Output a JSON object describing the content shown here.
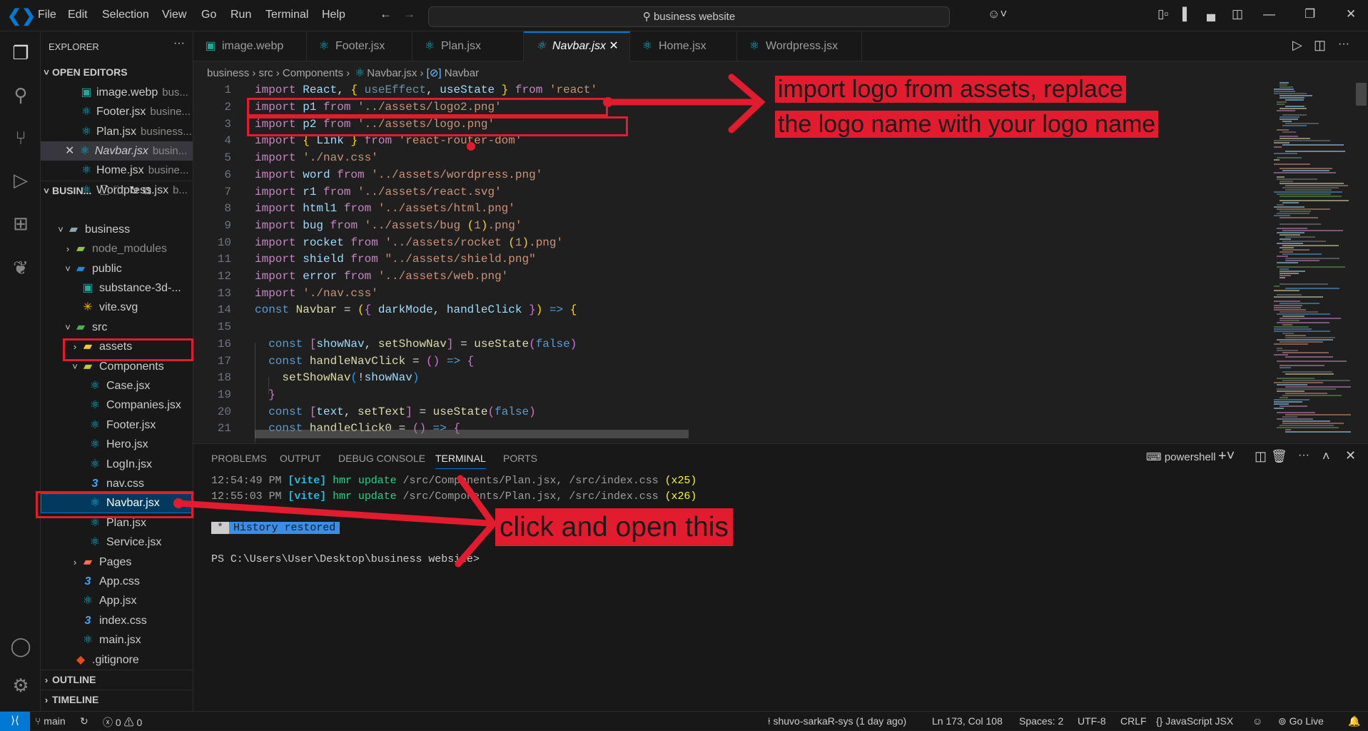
{
  "titlebar": {
    "menu": [
      "File",
      "Edit",
      "Selection",
      "View",
      "Go",
      "Run",
      "Terminal",
      "Help"
    ],
    "search": "business website"
  },
  "explorer": {
    "title": "EXPLORER",
    "open_editors_header": "OPEN EDITORS",
    "open_editors": [
      {
        "name": "image.webp",
        "desc": "bus...",
        "icon": "image"
      },
      {
        "name": "Footer.jsx",
        "desc": "busine...",
        "icon": "react"
      },
      {
        "name": "Plan.jsx",
        "desc": "business...",
        "icon": "react"
      },
      {
        "name": "Navbar.jsx",
        "desc": "busin...",
        "icon": "react",
        "active": true
      },
      {
        "name": "Home.jsx",
        "desc": "busine...",
        "icon": "react"
      },
      {
        "name": "Wordpress.jsx",
        "desc": "b...",
        "icon": "react"
      }
    ],
    "workspace_header": "BUSIN...",
    "tree": [
      {
        "label": "business",
        "depth": 0,
        "chevron": "open",
        "icon": "folder-open"
      },
      {
        "label": "node_modules",
        "depth": 1,
        "chevron": "closed",
        "icon": "folder-node",
        "dim": true
      },
      {
        "label": "public",
        "depth": 1,
        "chevron": "open",
        "icon": "folder-public"
      },
      {
        "label": "substance-3d-...",
        "depth": 2,
        "chevron": "none",
        "icon": "image"
      },
      {
        "label": "vite.svg",
        "depth": 2,
        "chevron": "none",
        "icon": "vite"
      },
      {
        "label": "src",
        "depth": 1,
        "chevron": "open",
        "icon": "folder-src"
      },
      {
        "label": "assets",
        "depth": 2,
        "chevron": "closed",
        "icon": "folder-assets"
      },
      {
        "label": "Components",
        "depth": 2,
        "chevron": "open",
        "icon": "folder-components"
      },
      {
        "label": "Case.jsx",
        "depth": 3,
        "chevron": "none",
        "icon": "react"
      },
      {
        "label": "Companies.jsx",
        "depth": 3,
        "chevron": "none",
        "icon": "react"
      },
      {
        "label": "Footer.jsx",
        "depth": 3,
        "chevron": "none",
        "icon": "react"
      },
      {
        "label": "Hero.jsx",
        "depth": 3,
        "chevron": "none",
        "icon": "react"
      },
      {
        "label": "LogIn.jsx",
        "depth": 3,
        "chevron": "none",
        "icon": "react"
      },
      {
        "label": "nav.css",
        "depth": 3,
        "chevron": "none",
        "icon": "css"
      },
      {
        "label": "Navbar.jsx",
        "depth": 3,
        "chevron": "none",
        "icon": "react",
        "selected": true
      },
      {
        "label": "Plan.jsx",
        "depth": 3,
        "chevron": "none",
        "icon": "react"
      },
      {
        "label": "Service.jsx",
        "depth": 3,
        "chevron": "none",
        "icon": "react"
      },
      {
        "label": "Pages",
        "depth": 2,
        "chevron": "closed",
        "icon": "folder-pages"
      },
      {
        "label": "App.css",
        "depth": 2,
        "chevron": "none",
        "icon": "css"
      },
      {
        "label": "App.jsx",
        "depth": 2,
        "chevron": "none",
        "icon": "react"
      },
      {
        "label": "index.css",
        "depth": 2,
        "chevron": "none",
        "icon": "css"
      },
      {
        "label": "main.jsx",
        "depth": 2,
        "chevron": "none",
        "icon": "react"
      },
      {
        "label": ".gitignore",
        "depth": 1,
        "chevron": "none",
        "icon": "git"
      }
    ],
    "outline": "OUTLINE",
    "timeline": "TIMELINE"
  },
  "tabs": [
    {
      "label": "image.webp",
      "icon": "image"
    },
    {
      "label": "Footer.jsx",
      "icon": "react"
    },
    {
      "label": "Plan.jsx",
      "icon": "react"
    },
    {
      "label": "Navbar.jsx",
      "icon": "react",
      "active": true
    },
    {
      "label": "Home.jsx",
      "icon": "react"
    },
    {
      "label": "Wordpress.jsx",
      "icon": "react"
    }
  ],
  "breadcrumb": [
    "business",
    "src",
    "Components",
    "Navbar.jsx",
    "Navbar"
  ],
  "code": [
    [
      [
        "import ",
        "kw"
      ],
      [
        "React",
        "var"
      ],
      [
        ", ",
        "op"
      ],
      [
        "{",
        "b1"
      ],
      [
        " useEffect",
        "dim"
      ],
      [
        ", ",
        "op"
      ],
      [
        "useState",
        "var"
      ],
      [
        " }",
        "b1"
      ],
      [
        " from ",
        "kw"
      ],
      [
        "'react'",
        "str"
      ]
    ],
    [
      [
        "import ",
        "kw"
      ],
      [
        "p1",
        "var"
      ],
      [
        " from ",
        "kw"
      ],
      [
        "'../assets/logo2.png'",
        "str"
      ]
    ],
    [
      [
        "import ",
        "kw"
      ],
      [
        "p2",
        "var"
      ],
      [
        " from ",
        "kw"
      ],
      [
        "'../assets/logo.png'",
        "str"
      ]
    ],
    [
      [
        "import ",
        "kw"
      ],
      [
        "{",
        "b1"
      ],
      [
        " Link ",
        "var"
      ],
      [
        "}",
        "b1"
      ],
      [
        " from ",
        "kw"
      ],
      [
        "'react-router-dom'",
        "str"
      ]
    ],
    [
      [
        "import ",
        "kw"
      ],
      [
        "'./nav.css'",
        "str"
      ]
    ],
    [
      [
        "import ",
        "kw"
      ],
      [
        "word",
        "var"
      ],
      [
        " from ",
        "kw"
      ],
      [
        "'../assets/wordpress.png'",
        "str"
      ]
    ],
    [
      [
        "import ",
        "kw"
      ],
      [
        "r1",
        "var"
      ],
      [
        " from ",
        "kw"
      ],
      [
        "'../assets/react.svg'",
        "str"
      ]
    ],
    [
      [
        "import ",
        "kw"
      ],
      [
        "html1",
        "var"
      ],
      [
        " from ",
        "kw"
      ],
      [
        "'../assets/html.png'",
        "str"
      ]
    ],
    [
      [
        "import ",
        "kw"
      ],
      [
        "bug",
        "var"
      ],
      [
        " from ",
        "kw"
      ],
      [
        "'../assets/bug ",
        "str"
      ],
      [
        "(",
        "b1"
      ],
      [
        "1",
        "str"
      ],
      [
        ")",
        "b1"
      ],
      [
        ".png'",
        "str"
      ]
    ],
    [
      [
        "import ",
        "kw"
      ],
      [
        "rocket",
        "var"
      ],
      [
        " from ",
        "kw"
      ],
      [
        "'../assets/rocket ",
        "str"
      ],
      [
        "(",
        "b1"
      ],
      [
        "1",
        "str"
      ],
      [
        ")",
        "b1"
      ],
      [
        ".png'",
        "str"
      ]
    ],
    [
      [
        "import ",
        "kw"
      ],
      [
        "shield",
        "var"
      ],
      [
        " from ",
        "kw"
      ],
      [
        "\"../assets/shield.png\"",
        "str"
      ]
    ],
    [
      [
        "import ",
        "kw"
      ],
      [
        "error",
        "var"
      ],
      [
        " from ",
        "kw"
      ],
      [
        "'../assets/web.png'",
        "str"
      ]
    ],
    [
      [
        "import ",
        "kw"
      ],
      [
        "'./nav.css'",
        "str"
      ]
    ],
    [
      [
        "const ",
        "dec"
      ],
      [
        "Navbar",
        "fn"
      ],
      [
        " = ",
        "op"
      ],
      [
        "(",
        "b1"
      ],
      [
        "{",
        "b2"
      ],
      [
        " darkMode",
        "var"
      ],
      [
        ", ",
        "op"
      ],
      [
        "handleClick ",
        "var"
      ],
      [
        "}",
        "b2"
      ],
      [
        ")",
        "b1"
      ],
      [
        " => ",
        "dec"
      ],
      [
        "{",
        "b1"
      ]
    ],
    [],
    [
      [
        "  const ",
        "dec"
      ],
      [
        "[",
        "b2"
      ],
      [
        "showNav",
        "var"
      ],
      [
        ", ",
        "op"
      ],
      [
        "setShowNav",
        "fn"
      ],
      [
        "]",
        "b2"
      ],
      [
        " = ",
        "op"
      ],
      [
        "useState",
        "fn"
      ],
      [
        "(",
        "b2"
      ],
      [
        "false",
        "dec"
      ],
      [
        ")",
        "b2"
      ]
    ],
    [
      [
        "  const ",
        "dec"
      ],
      [
        "handleNavClick",
        "fn"
      ],
      [
        " = ",
        "op"
      ],
      [
        "()",
        "b2"
      ],
      [
        " => ",
        "dec"
      ],
      [
        "{",
        "b2"
      ]
    ],
    [
      [
        "    setShowNav",
        "fn"
      ],
      [
        "(",
        "b3"
      ],
      [
        "!",
        "op"
      ],
      [
        "showNav",
        "var"
      ],
      [
        ")",
        "b3"
      ]
    ],
    [
      [
        "  }",
        "b2"
      ]
    ],
    [
      [
        "  const ",
        "dec"
      ],
      [
        "[",
        "b2"
      ],
      [
        "text",
        "var"
      ],
      [
        ", ",
        "op"
      ],
      [
        "setText",
        "fn"
      ],
      [
        "]",
        "b2"
      ],
      [
        " = ",
        "op"
      ],
      [
        "useState",
        "fn"
      ],
      [
        "(",
        "b2"
      ],
      [
        "false",
        "dec"
      ],
      [
        ")",
        "b2"
      ]
    ],
    [
      [
        "  const ",
        "dec"
      ],
      [
        "handleClick0",
        "fn"
      ],
      [
        " = ",
        "op"
      ],
      [
        "()",
        "b2"
      ],
      [
        " => ",
        "dec"
      ],
      [
        "{",
        "b2"
      ]
    ]
  ],
  "panel": {
    "tabs": [
      "PROBLEMS",
      "OUTPUT",
      "DEBUG CONSOLE",
      "TERMINAL",
      "PORTS"
    ],
    "active": "TERMINAL",
    "shell": "powershell",
    "terminal": [
      [
        [
          "12:54:49 PM ",
          "dim"
        ],
        [
          "[vite]",
          "vite"
        ],
        [
          " hmr update",
          "green"
        ],
        [
          " /src/Components/Plan.jsx, /src/index.css ",
          "gray"
        ],
        [
          "(x25)",
          "yellow"
        ]
      ],
      [
        [
          "12:55:03 PM ",
          "dim"
        ],
        [
          "[vite]",
          "vite"
        ],
        [
          " hmr update",
          "green"
        ],
        [
          " /src/Components/Plan.jsx, /src/index.css ",
          "gray"
        ],
        [
          "(x26)",
          "yellow"
        ]
      ]
    ],
    "history_marker": "*",
    "history": "History restored",
    "prompt": "PS C:\\Users\\User\\Desktop\\business website>"
  },
  "statusbar": {
    "branch": "main",
    "errors": "0",
    "warnings": "0",
    "blame": "shuvo-sarkaR-sys (1 day ago)",
    "position": "Ln 173, Col 108",
    "spaces": "Spaces: 2",
    "encoding": "UTF-8",
    "eol": "CRLF",
    "language": "JavaScript JSX",
    "golive": "Go Live"
  },
  "annotations": {
    "top": [
      "import logo from assets, replace",
      "the logo name with your logo name"
    ],
    "bottom": "click and open this"
  },
  "colors": {
    "accent": "#0078d4",
    "annotation_red": "#e31b2e",
    "react_icon": "#00bcd4",
    "selection": "#04395e"
  }
}
